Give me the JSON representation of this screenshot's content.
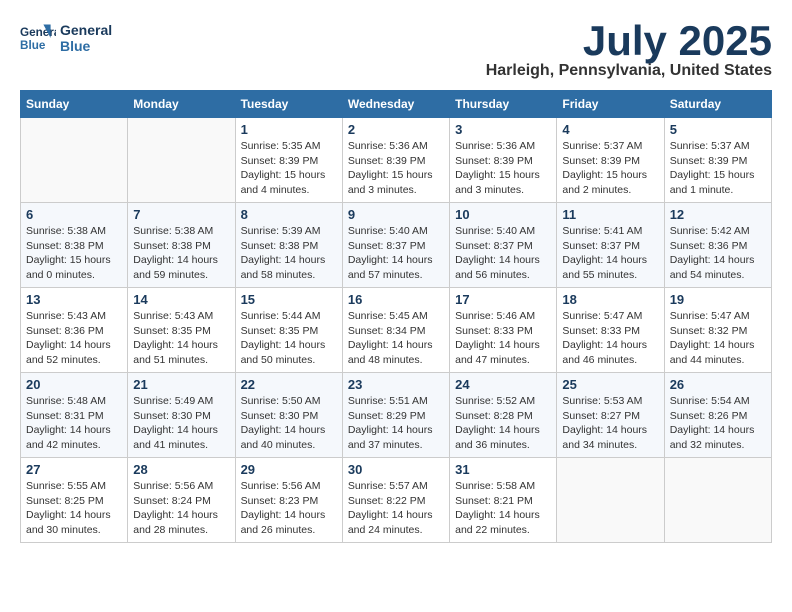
{
  "header": {
    "logo_line1": "General",
    "logo_line2": "Blue",
    "month": "July 2025",
    "location": "Harleigh, Pennsylvania, United States"
  },
  "weekdays": [
    "Sunday",
    "Monday",
    "Tuesday",
    "Wednesday",
    "Thursday",
    "Friday",
    "Saturday"
  ],
  "weeks": [
    [
      {
        "day": "",
        "empty": true
      },
      {
        "day": "",
        "empty": true
      },
      {
        "day": "1",
        "sunrise": "5:35 AM",
        "sunset": "8:39 PM",
        "daylight": "15 hours and 4 minutes."
      },
      {
        "day": "2",
        "sunrise": "5:36 AM",
        "sunset": "8:39 PM",
        "daylight": "15 hours and 3 minutes."
      },
      {
        "day": "3",
        "sunrise": "5:36 AM",
        "sunset": "8:39 PM",
        "daylight": "15 hours and 3 minutes."
      },
      {
        "day": "4",
        "sunrise": "5:37 AM",
        "sunset": "8:39 PM",
        "daylight": "15 hours and 2 minutes."
      },
      {
        "day": "5",
        "sunrise": "5:37 AM",
        "sunset": "8:39 PM",
        "daylight": "15 hours and 1 minute."
      }
    ],
    [
      {
        "day": "6",
        "sunrise": "5:38 AM",
        "sunset": "8:38 PM",
        "daylight": "15 hours and 0 minutes."
      },
      {
        "day": "7",
        "sunrise": "5:38 AM",
        "sunset": "8:38 PM",
        "daylight": "14 hours and 59 minutes."
      },
      {
        "day": "8",
        "sunrise": "5:39 AM",
        "sunset": "8:38 PM",
        "daylight": "14 hours and 58 minutes."
      },
      {
        "day": "9",
        "sunrise": "5:40 AM",
        "sunset": "8:37 PM",
        "daylight": "14 hours and 57 minutes."
      },
      {
        "day": "10",
        "sunrise": "5:40 AM",
        "sunset": "8:37 PM",
        "daylight": "14 hours and 56 minutes."
      },
      {
        "day": "11",
        "sunrise": "5:41 AM",
        "sunset": "8:37 PM",
        "daylight": "14 hours and 55 minutes."
      },
      {
        "day": "12",
        "sunrise": "5:42 AM",
        "sunset": "8:36 PM",
        "daylight": "14 hours and 54 minutes."
      }
    ],
    [
      {
        "day": "13",
        "sunrise": "5:43 AM",
        "sunset": "8:36 PM",
        "daylight": "14 hours and 52 minutes."
      },
      {
        "day": "14",
        "sunrise": "5:43 AM",
        "sunset": "8:35 PM",
        "daylight": "14 hours and 51 minutes."
      },
      {
        "day": "15",
        "sunrise": "5:44 AM",
        "sunset": "8:35 PM",
        "daylight": "14 hours and 50 minutes."
      },
      {
        "day": "16",
        "sunrise": "5:45 AM",
        "sunset": "8:34 PM",
        "daylight": "14 hours and 48 minutes."
      },
      {
        "day": "17",
        "sunrise": "5:46 AM",
        "sunset": "8:33 PM",
        "daylight": "14 hours and 47 minutes."
      },
      {
        "day": "18",
        "sunrise": "5:47 AM",
        "sunset": "8:33 PM",
        "daylight": "14 hours and 46 minutes."
      },
      {
        "day": "19",
        "sunrise": "5:47 AM",
        "sunset": "8:32 PM",
        "daylight": "14 hours and 44 minutes."
      }
    ],
    [
      {
        "day": "20",
        "sunrise": "5:48 AM",
        "sunset": "8:31 PM",
        "daylight": "14 hours and 42 minutes."
      },
      {
        "day": "21",
        "sunrise": "5:49 AM",
        "sunset": "8:30 PM",
        "daylight": "14 hours and 41 minutes."
      },
      {
        "day": "22",
        "sunrise": "5:50 AM",
        "sunset": "8:30 PM",
        "daylight": "14 hours and 40 minutes."
      },
      {
        "day": "23",
        "sunrise": "5:51 AM",
        "sunset": "8:29 PM",
        "daylight": "14 hours and 37 minutes."
      },
      {
        "day": "24",
        "sunrise": "5:52 AM",
        "sunset": "8:28 PM",
        "daylight": "14 hours and 36 minutes."
      },
      {
        "day": "25",
        "sunrise": "5:53 AM",
        "sunset": "8:27 PM",
        "daylight": "14 hours and 34 minutes."
      },
      {
        "day": "26",
        "sunrise": "5:54 AM",
        "sunset": "8:26 PM",
        "daylight": "14 hours and 32 minutes."
      }
    ],
    [
      {
        "day": "27",
        "sunrise": "5:55 AM",
        "sunset": "8:25 PM",
        "daylight": "14 hours and 30 minutes."
      },
      {
        "day": "28",
        "sunrise": "5:56 AM",
        "sunset": "8:24 PM",
        "daylight": "14 hours and 28 minutes."
      },
      {
        "day": "29",
        "sunrise": "5:56 AM",
        "sunset": "8:23 PM",
        "daylight": "14 hours and 26 minutes."
      },
      {
        "day": "30",
        "sunrise": "5:57 AM",
        "sunset": "8:22 PM",
        "daylight": "14 hours and 24 minutes."
      },
      {
        "day": "31",
        "sunrise": "5:58 AM",
        "sunset": "8:21 PM",
        "daylight": "14 hours and 22 minutes."
      },
      {
        "day": "",
        "empty": true
      },
      {
        "day": "",
        "empty": true
      }
    ]
  ]
}
